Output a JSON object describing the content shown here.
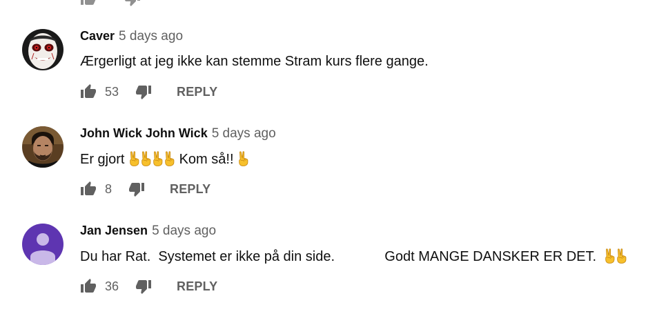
{
  "comments": [
    {
      "author": "Caver",
      "time": "5 days ago",
      "text": "Ærgerligt at jeg ikke kan stemme Stram kurs flere gange.",
      "likes": "53",
      "reply_label": "REPLY",
      "avatar": "creepy-face-avatar"
    },
    {
      "author": "John Wick John Wick",
      "time": "5 days ago",
      "text_before": "Er gjort ",
      "text_middle": " Kom så!! ",
      "emoji": "victory-hand-emoji",
      "likes": "8",
      "reply_label": "REPLY",
      "avatar": "bearded-man-avatar"
    },
    {
      "author": "Jan Jensen",
      "time": "5 days ago",
      "text": "Du har Rat.  Systemet er ikke på din side.             Godt MANGE DANSKER ER DET.  ",
      "emoji": "victory-hand-emoji",
      "likes": "36",
      "reply_label": "REPLY",
      "avatar": "default-person-avatar"
    }
  ],
  "colors": {
    "meta_gray": "#606060",
    "avatar_purple": "#5e35b1",
    "emoji_yellow": "#f7c02c"
  }
}
